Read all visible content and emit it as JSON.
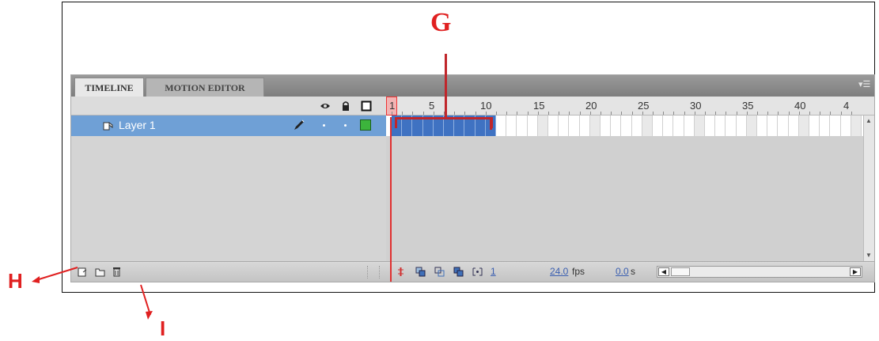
{
  "tabs": [
    {
      "label": "TIMELINE",
      "active": true
    },
    {
      "label": "MOTION EDITOR",
      "active": false
    }
  ],
  "header": {
    "icons": [
      "eye-icon",
      "lock-icon",
      "outline-icon"
    ],
    "frame_numbers": [
      "1",
      "5",
      "10",
      "15",
      "20",
      "25",
      "30",
      "35",
      "40",
      "4"
    ]
  },
  "layer": {
    "name": "Layer 1",
    "icons": [
      "layer-icon",
      "pencil-icon",
      "visible-dot-icon",
      "locked-dot-icon",
      "outline-color-icon"
    ],
    "outline_color": "#3cb43c",
    "filled_frames": 10
  },
  "bottom_bar": {
    "icons_left": [
      "new-layer-icon",
      "new-folder-icon",
      "delete-icon"
    ],
    "icons_right": [
      "center-frame-icon",
      "onion-skin-icon",
      "onion-skin-outlines-icon",
      "edit-multiple-frames-icon",
      "modify-onion-markers-icon"
    ],
    "current_frame": "1",
    "frame_rate": "24.0",
    "frame_rate_unit": "fps",
    "elapsed_time": "0.0",
    "elapsed_time_unit": "s"
  },
  "annotations": {
    "g": "G",
    "h": "H",
    "i": "I",
    "color": "#e02020"
  }
}
